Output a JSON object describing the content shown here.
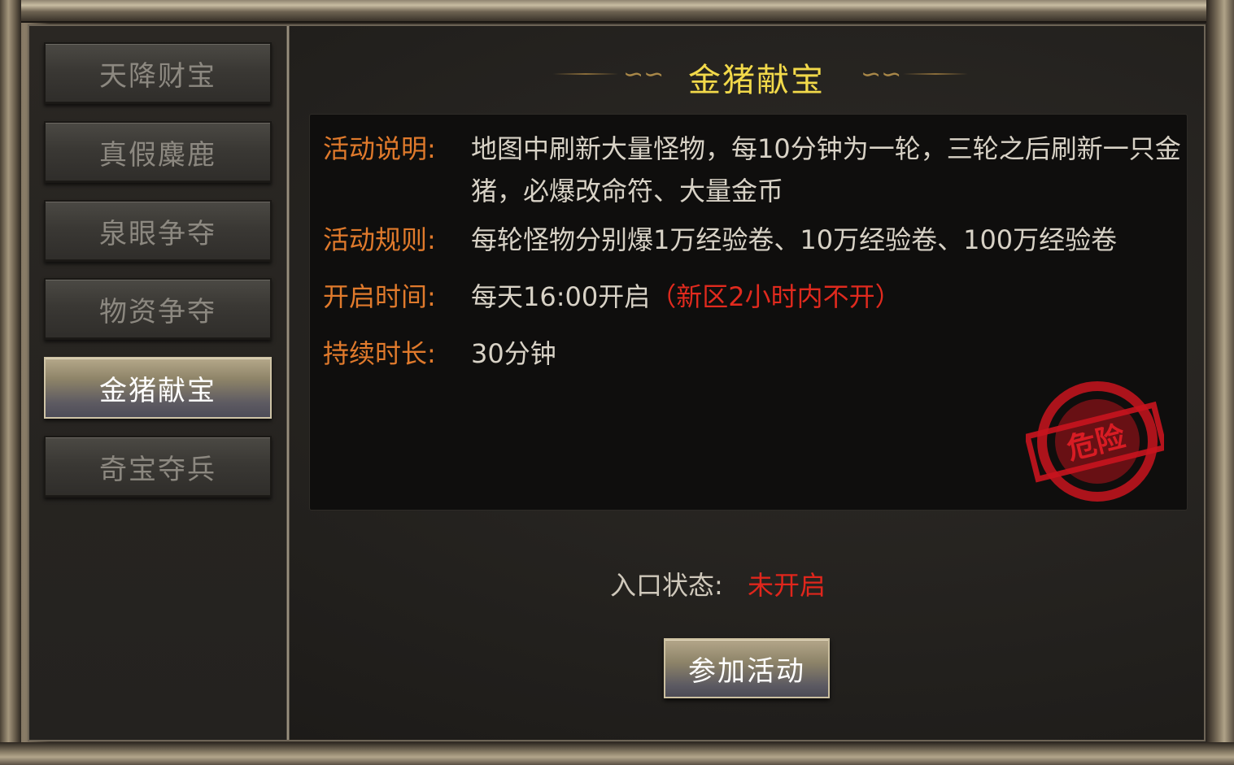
{
  "sidebar": {
    "items": [
      {
        "label": "天降财宝"
      },
      {
        "label": "真假麋鹿"
      },
      {
        "label": "泉眼争夺"
      },
      {
        "label": "物资争夺"
      },
      {
        "label": "金猪献宝",
        "active": true
      },
      {
        "label": "奇宝夺兵"
      }
    ]
  },
  "panel": {
    "title": "金猪献宝",
    "description_label": "活动说明:",
    "description_text": "地图中刷新大量怪物，每10分钟为一轮，三轮之后刷新一只金猪，必爆改命符、大量金币",
    "rules_label": "活动规则:",
    "rules_text": "每轮怪物分别爆1万经验卷、10万经验卷、100万经验卷",
    "time_label": "开启时间:",
    "time_text": "每天16:00开启",
    "time_note": "（新区2小时内不开）",
    "duration_label": "持续时长:",
    "duration_text": "30分钟",
    "stamp_text": "危险",
    "entry_status_label": "入口状态:",
    "entry_status_value": "未开启",
    "join_button": "参加活动"
  },
  "colors": {
    "title": "#f2d94a",
    "label_orange": "#e07a2c",
    "alert_red": "#e02a1e",
    "stamp_red": "#c8141e"
  },
  "icons": [
    "scroll-ornament-left-icon",
    "scroll-ornament-right-icon",
    "danger-stamp-icon"
  ]
}
